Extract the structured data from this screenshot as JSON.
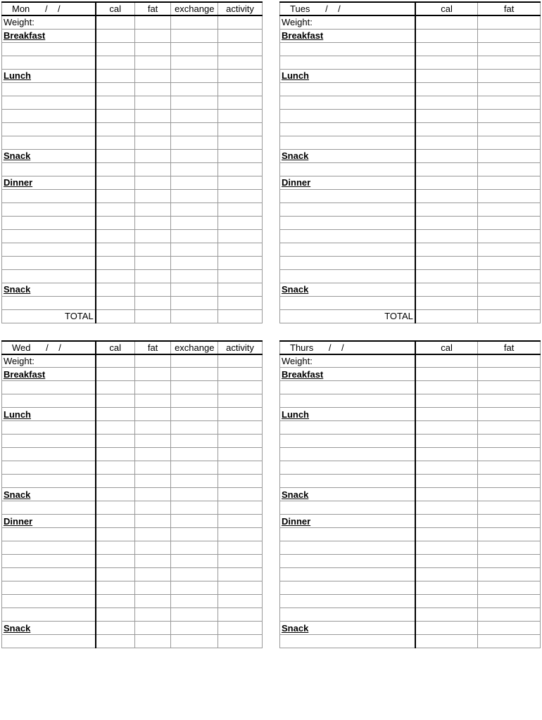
{
  "labels": {
    "weight": "Weight:",
    "breakfast": "Breakfast",
    "lunch": "Lunch",
    "snack": "Snack",
    "dinner": "Dinner",
    "total": "TOTAL",
    "date_sep": "/"
  },
  "cols": {
    "cal": "cal",
    "fat": "fat",
    "exchange": "exchange",
    "activity": "activity"
  },
  "days": {
    "mon": {
      "name": "Mon",
      "wide": true,
      "has_total": true
    },
    "tues": {
      "name": "Tues",
      "wide": false,
      "has_total": true
    },
    "wed": {
      "name": "Wed",
      "wide": true,
      "has_total": false
    },
    "thurs": {
      "name": "Thurs",
      "wide": false,
      "has_total": false
    }
  },
  "blanks": {
    "after_breakfast": 2,
    "after_lunch": 5,
    "after_snack1": 1,
    "after_dinner": 7,
    "after_snack2": 1
  }
}
